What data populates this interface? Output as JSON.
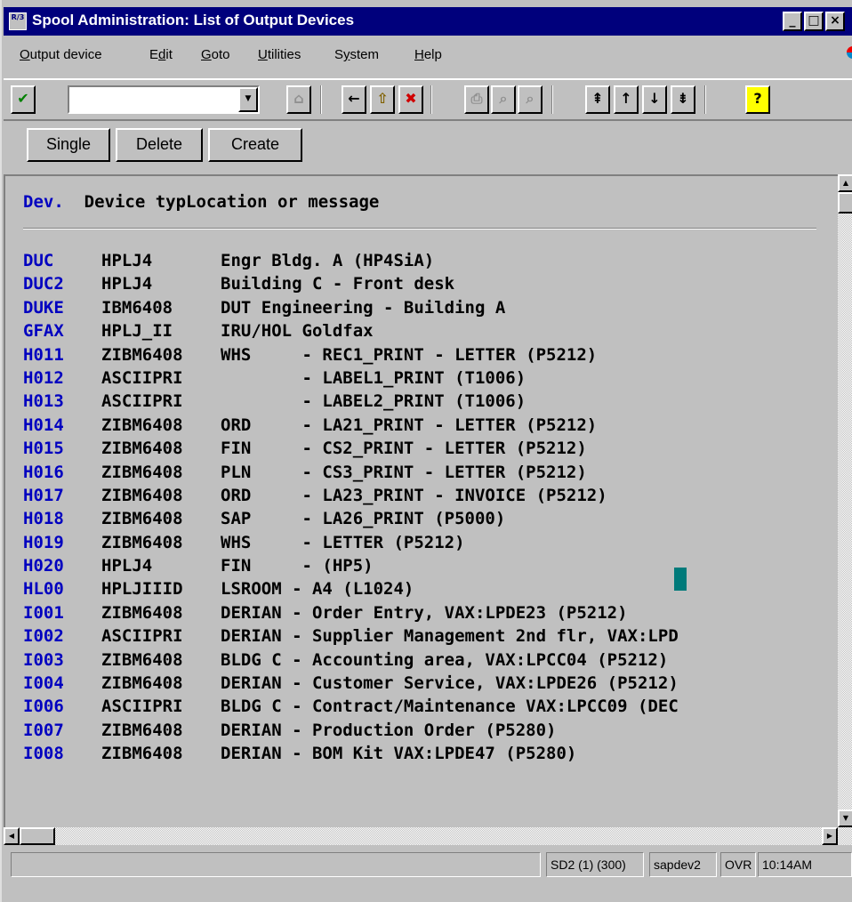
{
  "window": {
    "title": "Spool Administration: List of Output Devices",
    "icon_text": "R/3"
  },
  "menu": [
    {
      "label": "Output device",
      "ul": "O"
    },
    {
      "label": "Edit",
      "ul": "d"
    },
    {
      "label": "Goto",
      "ul": "G"
    },
    {
      "label": "Utilities",
      "ul": "U"
    },
    {
      "label": "System",
      "ul": "y"
    },
    {
      "label": "Help",
      "ul": "H"
    }
  ],
  "toolbar": {
    "command_field_value": "",
    "enter_icon": "check-icon",
    "icons": [
      "check-icon",
      "save-icon",
      "back-icon",
      "exit-icon",
      "cancel-icon",
      "print-icon",
      "find-icon",
      "find-next-icon",
      "first-page-icon",
      "previous-page-icon",
      "next-page-icon",
      "last-page-icon",
      "help-icon"
    ]
  },
  "app_buttons": {
    "single": "Single",
    "delete": "Delete",
    "create": "Create"
  },
  "list": {
    "header_dev": "Dev.",
    "header_rest": "  Device typLocation or message",
    "rows": [
      {
        "dev": "DUC",
        "typ": "HPLJ4",
        "msg": "Engr Bldg. A (HP4SiA)"
      },
      {
        "dev": "DUC2",
        "typ": "HPLJ4",
        "msg": "Building C - Front desk"
      },
      {
        "dev": "DUKE",
        "typ": "IBM6408",
        "msg": "DUT Engineering - Building A"
      },
      {
        "dev": "GFAX",
        "typ": "HPLJ_II",
        "msg": "IRU/HOL Goldfax"
      },
      {
        "dev": "H011",
        "typ": "ZIBM6408",
        "msg": "WHS     - REC1_PRINT - LETTER (P5212)"
      },
      {
        "dev": "H012",
        "typ": "ASCIIPRI",
        "msg": "        - LABEL1_PRINT (T1006)"
      },
      {
        "dev": "H013",
        "typ": "ASCIIPRI",
        "msg": "        - LABEL2_PRINT (T1006)"
      },
      {
        "dev": "H014",
        "typ": "ZIBM6408",
        "msg": "ORD     - LA21_PRINT - LETTER (P5212)"
      },
      {
        "dev": "H015",
        "typ": "ZIBM6408",
        "msg": "FIN     - CS2_PRINT - LETTER (P5212)"
      },
      {
        "dev": "H016",
        "typ": "ZIBM6408",
        "msg": "PLN     - CS3_PRINT - LETTER (P5212)"
      },
      {
        "dev": "H017",
        "typ": "ZIBM6408",
        "msg": "ORD     - LA23_PRINT - INVOICE (P5212)"
      },
      {
        "dev": "H018",
        "typ": "ZIBM6408",
        "msg": "SAP     - LA26_PRINT (P5000)"
      },
      {
        "dev": "H019",
        "typ": "ZIBM6408",
        "msg": "WHS     - LETTER (P5212)"
      },
      {
        "dev": "H020",
        "typ": "HPLJ4",
        "msg": "FIN     - (HP5)"
      },
      {
        "dev": "HL00",
        "typ": "HPLJIIID",
        "msg": "LSROOM - A4 (L1024)"
      },
      {
        "dev": "I001",
        "typ": "ZIBM6408",
        "msg": "DERIAN - Order Entry, VAX:LPDE23 (P5212)"
      },
      {
        "dev": "I002",
        "typ": "ASCIIPRI",
        "msg": "DERIAN - Supplier Management 2nd flr, VAX:LPD"
      },
      {
        "dev": "I003",
        "typ": "ZIBM6408",
        "msg": "BLDG C - Accounting area, VAX:LPCC04 (P5212)"
      },
      {
        "dev": "I004",
        "typ": "ZIBM6408",
        "msg": "DERIAN - Customer Service, VAX:LPDE26 (P5212)"
      },
      {
        "dev": "I006",
        "typ": "ASCIIPRI",
        "msg": "BLDG C - Contract/Maintenance VAX:LPCC09 (DEC"
      },
      {
        "dev": "I007",
        "typ": "ZIBM6408",
        "msg": "DERIAN - Production Order (P5280)"
      },
      {
        "dev": "I008",
        "typ": "ZIBM6408",
        "msg": "DERIAN - BOM Kit VAX:LPDE47 (P5280)"
      }
    ]
  },
  "status": {
    "message": "",
    "system": "SD2 (1) (300)",
    "server": "sapdev2",
    "mode": "OVR",
    "time": "10:14AM"
  },
  "colors": {
    "titlebar": "#00007c",
    "key_text": "#0000c0",
    "cursor": "#007a7a",
    "background": "#c0c0c0"
  }
}
